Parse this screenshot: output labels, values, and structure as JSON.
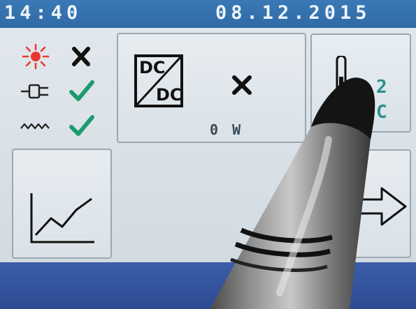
{
  "status_bar": {
    "time": "14:40",
    "date": "08.12.2015"
  },
  "sources": [
    {
      "name": "solar",
      "icon": "sun-icon",
      "state": "unavailable",
      "state_icon": "cross-icon"
    },
    {
      "name": "grid",
      "icon": "plug-icon",
      "state": "available",
      "state_icon": "check-icon"
    },
    {
      "name": "wave",
      "icon": "wave-icon",
      "state": "available",
      "state_icon": "check-icon"
    }
  ],
  "dcdc": {
    "label_top": "DC",
    "label_bottom": "DC",
    "state_icon": "cross-icon",
    "power": "0 W"
  },
  "temperature": {
    "line1": "2",
    "line2": "C"
  },
  "colors": {
    "status_bar": "#2f6aa6",
    "bottom_bar": "#2c4c93",
    "check": "#1e9b6e",
    "cross": "#111111",
    "sun": "#e8382f",
    "temp_text": "#2d8f8f"
  }
}
